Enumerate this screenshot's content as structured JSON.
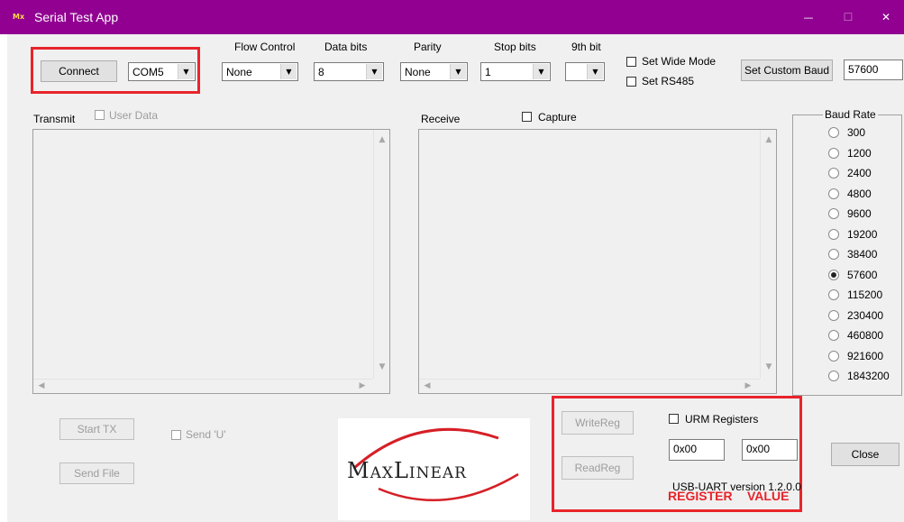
{
  "window": {
    "title": "Serial Test App",
    "app_icon_text": "Mx",
    "minimize_glyph": "—",
    "maximize_glyph": "☐",
    "close_glyph": "✕",
    "titlebar_color": "#910091"
  },
  "connection": {
    "connect_label": "Connect",
    "port_value": "COM5"
  },
  "settings": {
    "flow_control": {
      "label": "Flow Control",
      "value": "None"
    },
    "data_bits": {
      "label": "Data bits",
      "value": "8"
    },
    "parity": {
      "label": "Parity",
      "value": "None"
    },
    "stop_bits": {
      "label": "Stop bits",
      "value": "1"
    },
    "ninth_bit": {
      "label": "9th bit",
      "value": ""
    },
    "set_wide_mode_label": "Set Wide Mode",
    "set_rs485_label": "Set RS485",
    "set_custom_baud_label": "Set Custom Baud",
    "custom_baud_value": "57600"
  },
  "transmit": {
    "label": "Transmit",
    "user_data_label": "User Data",
    "start_tx_label": "Start TX",
    "send_file_label": "Send File",
    "send_u_label": "Send 'U'"
  },
  "receive": {
    "label": "Receive",
    "capture_label": "Capture"
  },
  "baud_rate": {
    "title": "Baud Rate",
    "options": [
      "300",
      "1200",
      "2400",
      "4800",
      "9600",
      "19200",
      "38400",
      "57600",
      "115200",
      "230400",
      "460800",
      "921600",
      "1843200"
    ],
    "selected": "57600"
  },
  "registers": {
    "write_reg_label": "WriteReg",
    "read_reg_label": "ReadReg",
    "urm_registers_label": "URM Registers",
    "register_value": "0x00",
    "value_value": "0x00",
    "version_text": "USB-UART version 1.2.0.0",
    "register_annotation": "REGISTER",
    "value_annotation": "VALUE"
  },
  "logo": {
    "text": "MaxLinear"
  },
  "close_label": "Close",
  "colors": {
    "highlight_red": "#e8242b",
    "logo_swoosh_red": "#d61f26"
  },
  "icons": {
    "scroll_up": "▲",
    "scroll_down": "▼",
    "scroll_left": "◀",
    "scroll_right": "▶",
    "combo_arrow": "▼"
  }
}
